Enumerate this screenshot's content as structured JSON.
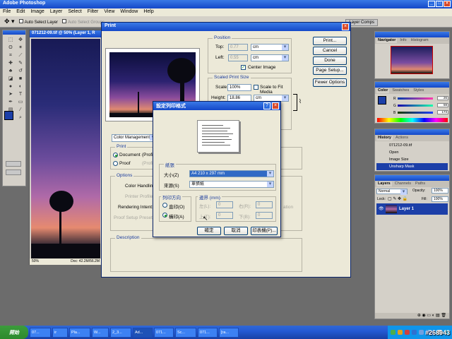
{
  "app": {
    "title": "Adobe Photoshop",
    "menu": [
      "File",
      "Edit",
      "Image",
      "Layer",
      "Select",
      "Filter",
      "View",
      "Window",
      "Help"
    ]
  },
  "options_bar": {
    "auto_select_layer": "Auto Select Layer",
    "auto_select_groups": "Auto Select Groups",
    "layer_comps_tab": "Layer Comps"
  },
  "document": {
    "title": "071212-09.tif @ 50% (Layer 1, R",
    "zoom": "50%",
    "doc_size": "Doc: 42.2M/56.2M"
  },
  "print_dialog": {
    "title": "Print",
    "close": "×",
    "buttons": [
      "Print...",
      "Cancel",
      "Done",
      "Page Setup...",
      "Fewer Options"
    ],
    "position": {
      "title": "Position",
      "top_label": "Top:",
      "top_value": "0.77",
      "left_label": "Left:",
      "left_value": "0.55",
      "unit": "cm",
      "center_image": "Center Image"
    },
    "scaled": {
      "title": "Scaled Print Size",
      "scale_label": "Scale:",
      "scale_value": "100%",
      "fit_media": "Scale to Fit Media",
      "height_label": "Height:",
      "height_value": "18.86",
      "unit": "cm"
    },
    "color_mgmt": {
      "select_value": "Color Management",
      "print_title": "Print",
      "document": "Document",
      "document_profile": "(Profi",
      "proof": "Proof",
      "proof_profile": "(Profi",
      "options_title": "Options",
      "color_handling": "Color Handling:",
      "printer_profile": "Printer Profile",
      "rendering_intent": "Rendering Intent:",
      "proof_setup": "Proof Setup Preset",
      "compensation": "ation",
      "description_title": "Description"
    }
  },
  "page_setup": {
    "title": "設定列印格式",
    "help": "?",
    "close": "×",
    "paper_title": "紙張",
    "size_label": "大小(Z)",
    "size_value": "A4 210 x 297 mm",
    "source_label": "來源(S)",
    "source_value": "單張紙",
    "orientation_title": "列印方向",
    "portrait": "直印(O)",
    "landscape": "橫印(A)",
    "margins_title": "邊界 (mm)",
    "left_label": "左(L):",
    "left_value": "0",
    "right_label": "右(R):",
    "right_value": "0",
    "top_label": "上(T):",
    "top_value": "0",
    "bottom_label": "下(B):",
    "bottom_value": "0",
    "ok": "確定",
    "cancel": "取消",
    "printer": "印表機(P)..."
  },
  "panels": {
    "navigator_tabs": [
      "Navigator",
      "Info",
      "Histogram"
    ],
    "color_tabs": [
      "Color",
      "Swatches",
      "Styles"
    ],
    "color_values": [
      "26",
      "59",
      "173"
    ],
    "history_tabs": [
      "History",
      "Actions"
    ],
    "history_items": [
      "071212-09.tif",
      "Open",
      "Image Size",
      "Unsharp Mask"
    ],
    "layers_tabs": [
      "Layers",
      "Channels",
      "Paths"
    ],
    "blend_mode": "Normal",
    "opacity_label": "Opacity:",
    "opacity": "100%",
    "lock_label": "Lock:",
    "fill_label": "Fill:",
    "fill": "100%",
    "layer_name": "Layer 1"
  },
  "taskbar": {
    "start": "開始",
    "tasks": [
      "07...",
      "ir",
      "Pla...",
      "W...",
      "2_3...",
      "Ad...",
      "071...",
      "Sc...",
      "071...",
      "[ra..."
    ],
    "tray_lang": "CH",
    "clock": ""
  },
  "watermark": "#268943",
  "colors": {
    "selection": "#1c3fa8",
    "dialog_bg": "#ece9d8",
    "titlebar": "#1448c8"
  }
}
